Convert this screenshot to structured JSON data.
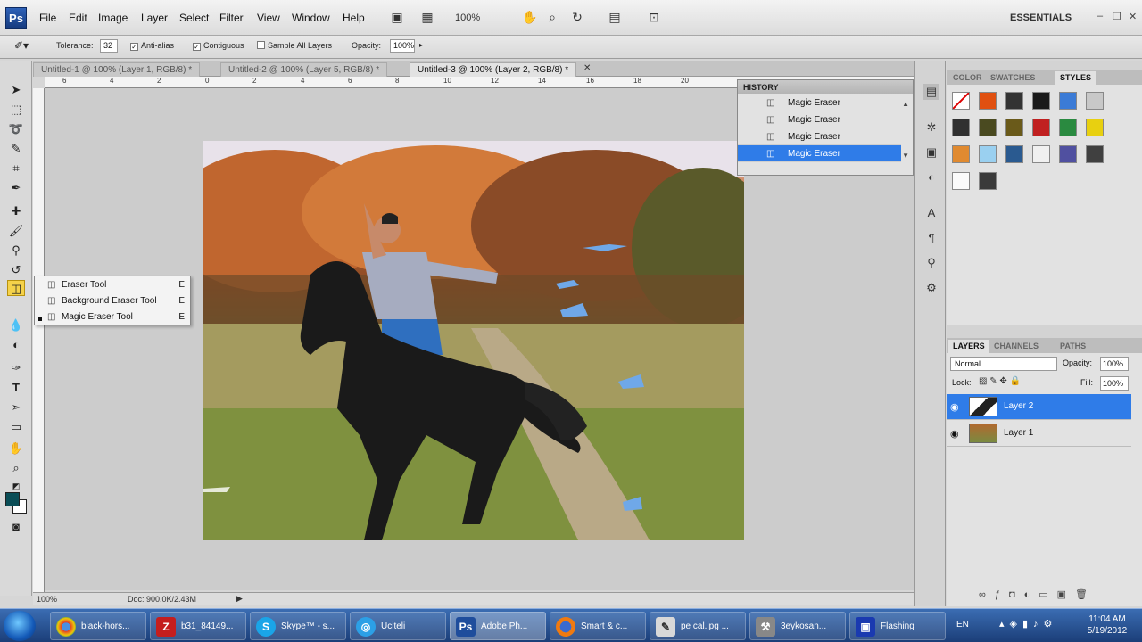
{
  "menubar": {
    "logo": "Ps",
    "items": [
      "File",
      "Edit",
      "Image",
      "Layer",
      "Select",
      "Filter",
      "View",
      "Window",
      "Help"
    ],
    "zoom": "100%",
    "workspace": "ESSENTIALS"
  },
  "options": {
    "tolerance_label": "Tolerance:",
    "tolerance_value": "32",
    "anti_alias": "Anti-alias",
    "contiguous": "Contiguous",
    "sample_all": "Sample All Layers",
    "opacity_label": "Opacity:",
    "opacity_value": "100%"
  },
  "tabs": [
    {
      "label": "Untitled-1 @ 100% (Layer 1, RGB/8) *"
    },
    {
      "label": "Untitled-2 @ 100% (Layer 5, RGB/8) *"
    },
    {
      "label": "Untitled-3 @ 100% (Layer 2, RGB/8) *"
    }
  ],
  "ruler_top": [
    "6",
    "4",
    "2",
    "0",
    "2",
    "4",
    "6",
    "8",
    "10",
    "12",
    "14",
    "16",
    "18",
    "20"
  ],
  "status": {
    "zoom": "100%",
    "doc": "Doc: 900.0K/2.43M"
  },
  "flyout": {
    "items": [
      {
        "label": "Eraser Tool",
        "key": "E"
      },
      {
        "label": "Background Eraser Tool",
        "key": "E"
      },
      {
        "label": "Magic Eraser Tool",
        "key": "E"
      }
    ]
  },
  "history": {
    "title": "HISTORY",
    "rows": [
      "Magic Eraser",
      "Magic Eraser",
      "Magic Eraser",
      "Magic Eraser"
    ]
  },
  "styles_panel": {
    "tabs": [
      "COLOR",
      "SWATCHES",
      "STYLES"
    ]
  },
  "layers_panel": {
    "tabs": [
      "LAYERS",
      "CHANNELS",
      "PATHS"
    ],
    "blend_mode": "Normal",
    "opacity_label": "Opacity:",
    "opacity_value": "100%",
    "lock_label": "Lock:",
    "fill_label": "Fill:",
    "fill_value": "100%",
    "layers": [
      "Layer 2",
      "Layer 1"
    ]
  },
  "taskbar": {
    "items": [
      {
        "label": "black-hors..."
      },
      {
        "label": "b31_84149..."
      },
      {
        "label": "Skype™ - s..."
      },
      {
        "label": "Uciteli"
      },
      {
        "label": "Adobe Ph..."
      },
      {
        "label": "Smart & c..."
      },
      {
        "label": "pe cal.jpg ..."
      },
      {
        "label": "3eykosan..."
      },
      {
        "label": "Flashing"
      }
    ],
    "lang": "EN",
    "time": "11:04 AM",
    "date": "5/19/2012"
  },
  "colors": {
    "selection": "#2f7ce8",
    "foreground": "#0a4d56",
    "active_tool": "#f5d24a"
  }
}
